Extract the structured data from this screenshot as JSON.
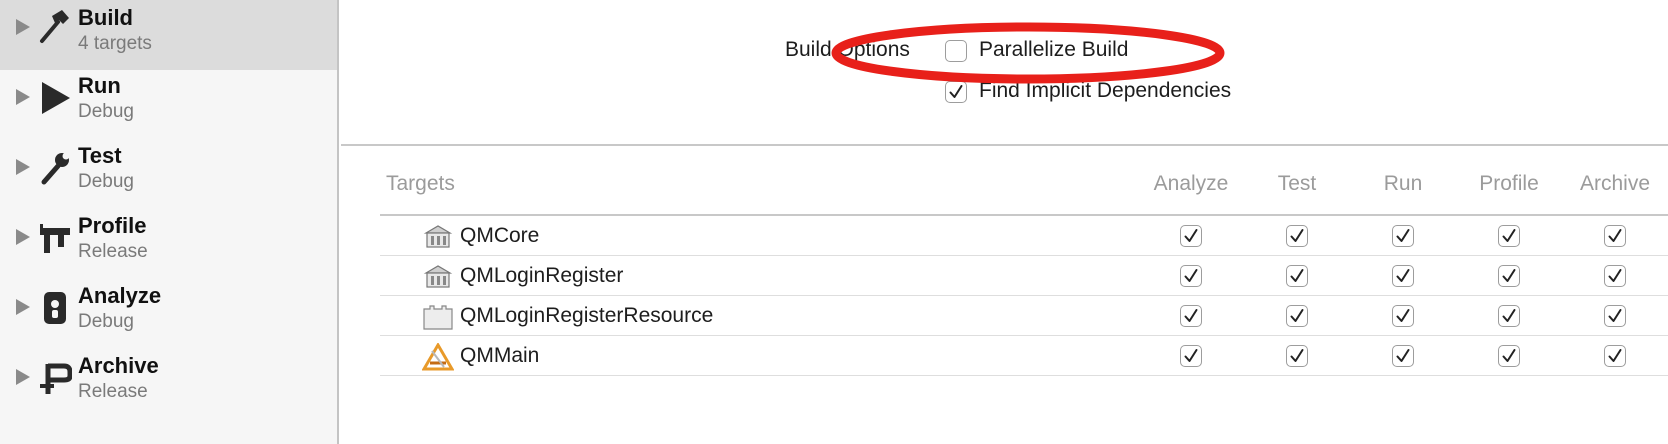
{
  "sidebar": {
    "items": [
      {
        "title": "Build",
        "subtitle": "4 targets",
        "icon": "hammer-icon",
        "selected": true
      },
      {
        "title": "Run",
        "subtitle": "Debug",
        "icon": "play-icon",
        "selected": false
      },
      {
        "title": "Test",
        "subtitle": "Debug",
        "icon": "wrench-icon",
        "selected": false
      },
      {
        "title": "Profile",
        "subtitle": "Release",
        "icon": "caliper-icon",
        "selected": false
      },
      {
        "title": "Analyze",
        "subtitle": "Debug",
        "icon": "analyze-icon",
        "selected": false
      },
      {
        "title": "Archive",
        "subtitle": "Release",
        "icon": "archive-clamp-icon",
        "selected": false
      }
    ]
  },
  "build_options": {
    "label": "Build Options",
    "parallelize": {
      "label": "Parallelize Build",
      "checked": false
    },
    "implicit": {
      "label": "Find Implicit Dependencies",
      "checked": true
    }
  },
  "table": {
    "headers": {
      "targets": "Targets",
      "analyze": "Analyze",
      "test": "Test",
      "run": "Run",
      "profile": "Profile",
      "archive": "Archive"
    },
    "rows": [
      {
        "name": "QMCore",
        "icon": "framework-icon",
        "analyze": true,
        "test": true,
        "run": true,
        "profile": true,
        "archive": true
      },
      {
        "name": "QMLoginRegister",
        "icon": "framework-icon",
        "analyze": true,
        "test": true,
        "run": true,
        "profile": true,
        "archive": true
      },
      {
        "name": "QMLoginRegisterResource",
        "icon": "bundle-icon",
        "analyze": true,
        "test": true,
        "run": true,
        "profile": true,
        "archive": true
      },
      {
        "name": "QMMain",
        "icon": "app-icon",
        "analyze": true,
        "test": true,
        "run": true,
        "profile": true,
        "archive": true
      }
    ]
  },
  "colors": {
    "annotation": "#e8201a",
    "sidebar_bg": "#f6f6f6",
    "selected_bg": "#dcdcdc",
    "header_text": "#9b9b9b"
  }
}
